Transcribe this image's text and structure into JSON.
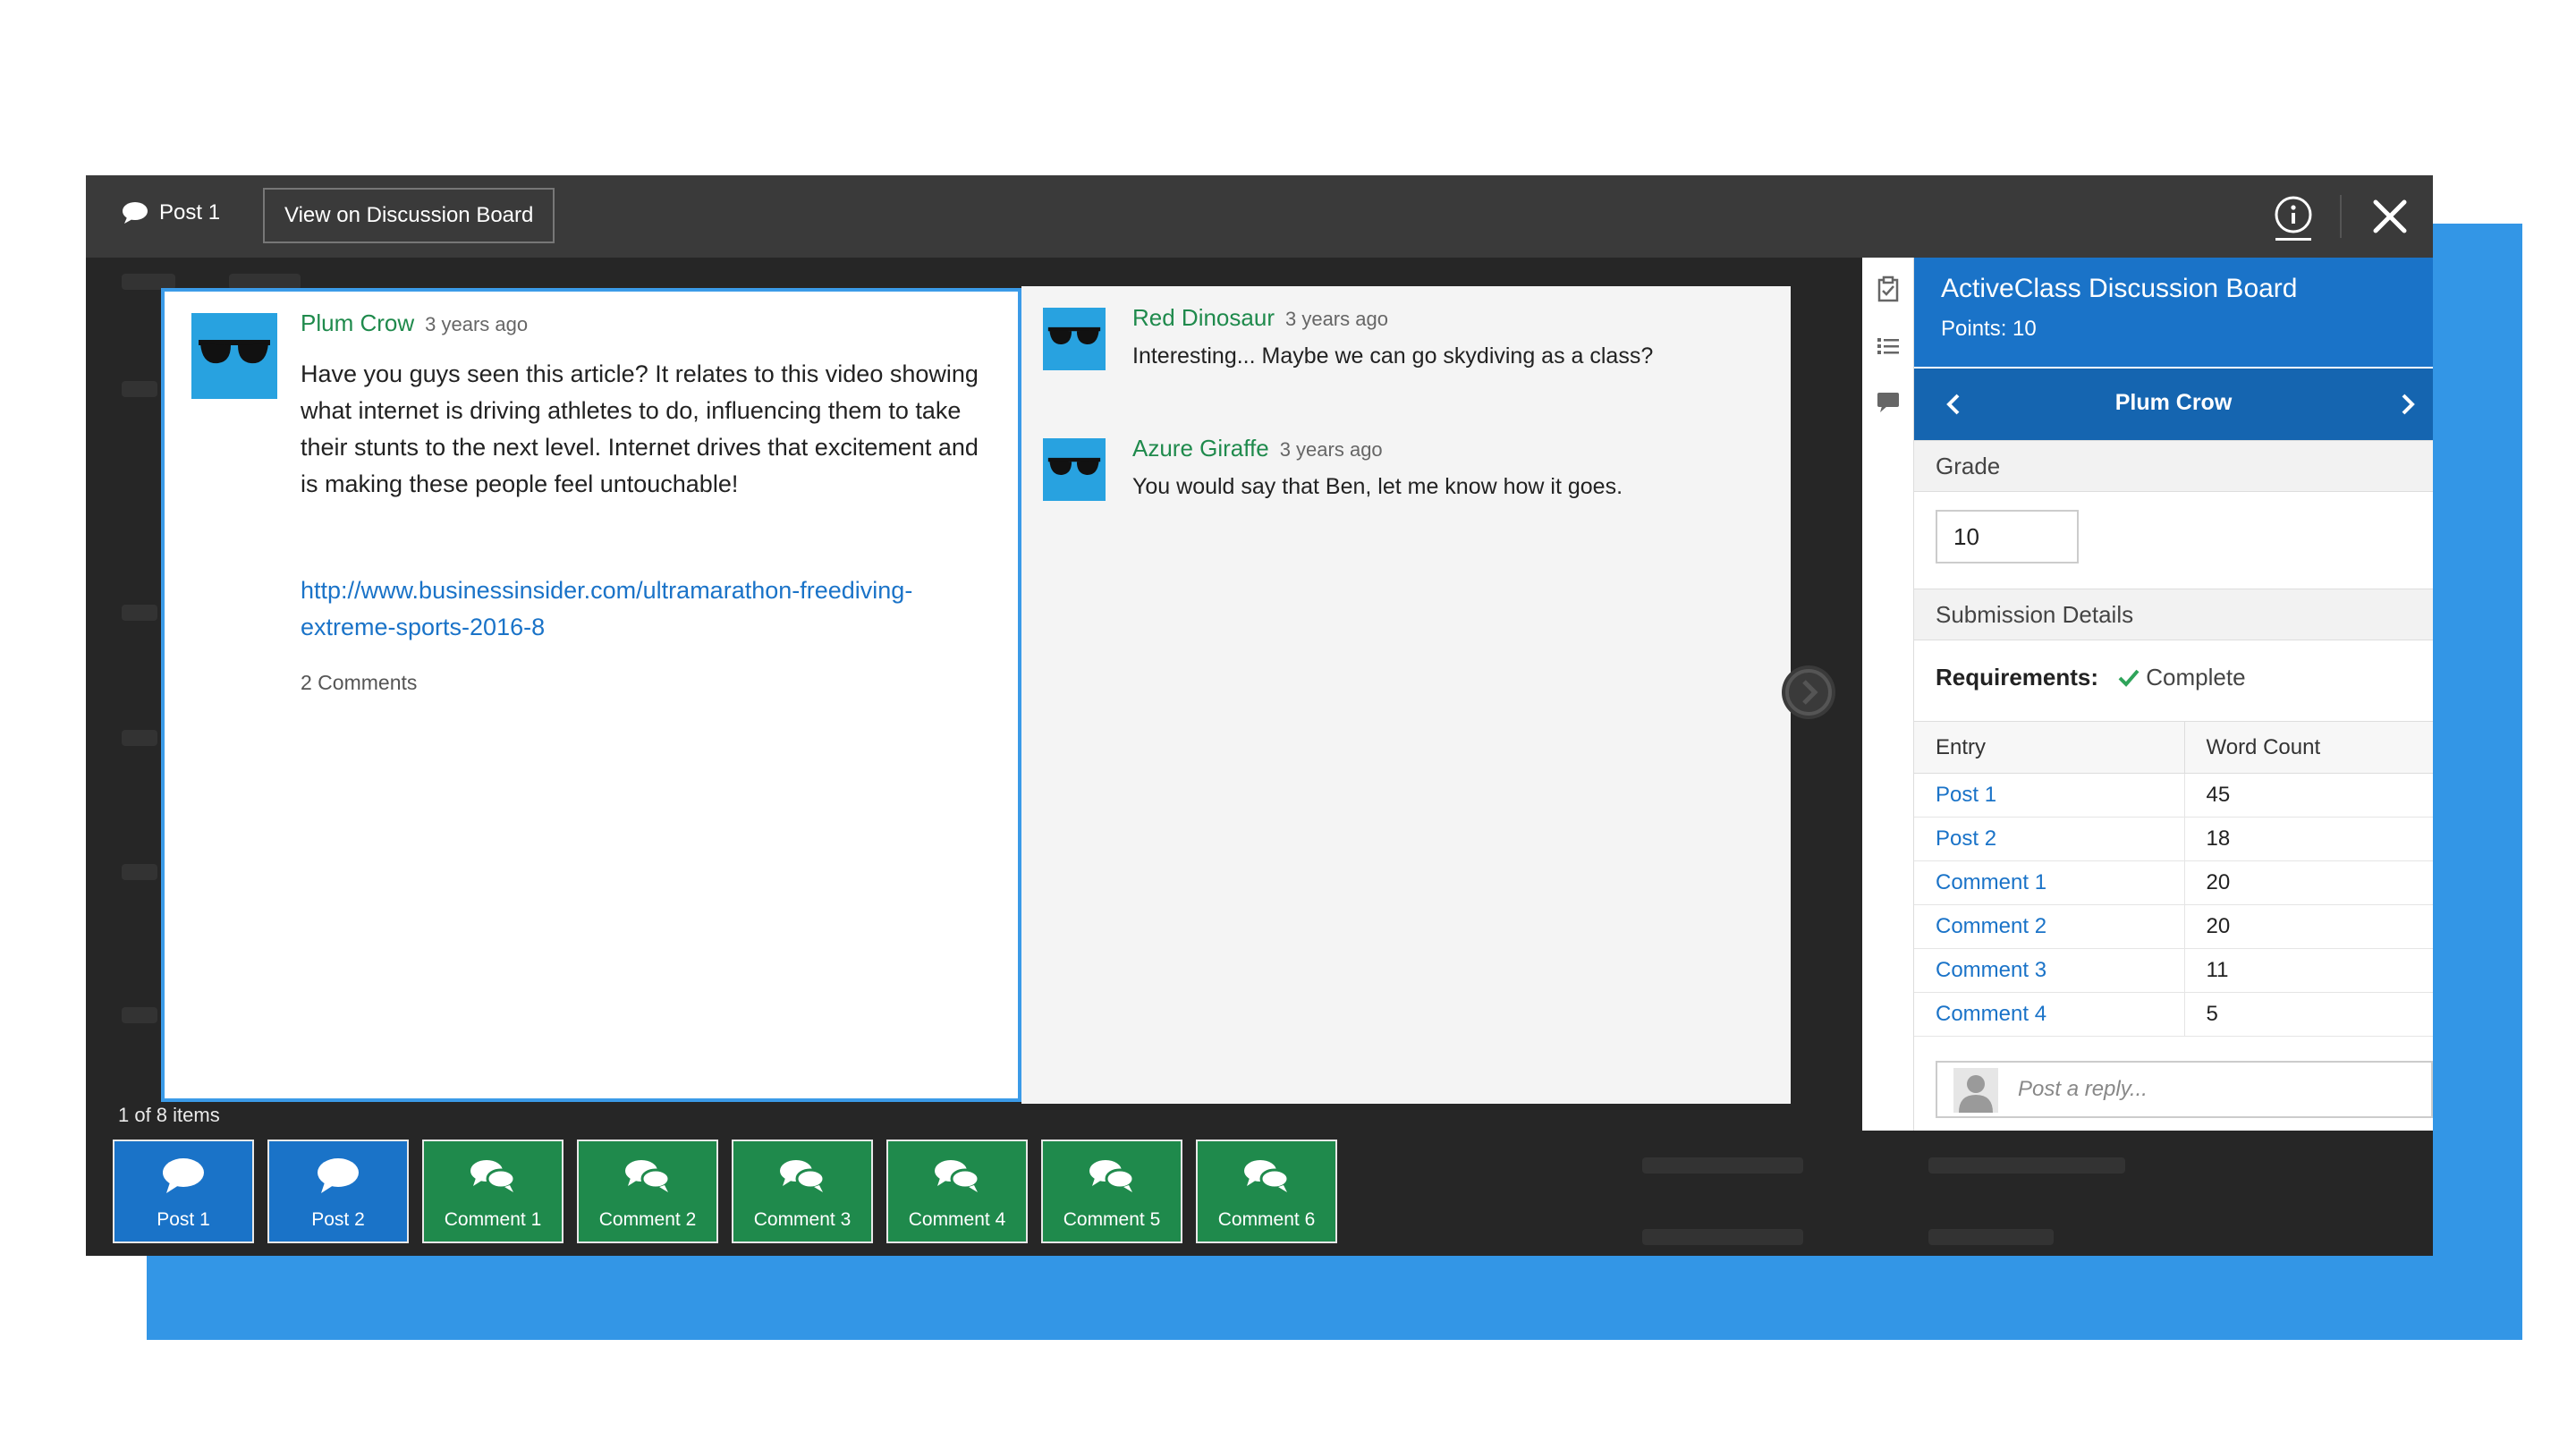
{
  "header": {
    "post_label": "Post 1",
    "view_button": "View on Discussion Board"
  },
  "post": {
    "author": "Plum Crow",
    "time": "3 years ago",
    "body": "Have you guys seen this article? It relates to this video showing what internet is driving athletes to do, influencing them to take their stunts to the next level. Internet drives that excitement and is making these people feel untouchable!",
    "link": "http://www.businessinsider.com/ultramarathon-freediving-extreme-sports-2016-8",
    "comments_count": "2 Comments"
  },
  "comments": [
    {
      "author": "Red Dinosaur",
      "time": "3 years ago",
      "text": "Interesting... Maybe we can go skydiving as a class?"
    },
    {
      "author": "Azure Giraffe",
      "time": "3 years ago",
      "text": "You would say that Ben, let me know how it goes."
    }
  ],
  "footer": {
    "items_count": "1 of 8 items",
    "tiles": [
      {
        "label": "Post 1",
        "kind": "post"
      },
      {
        "label": "Post 2",
        "kind": "post"
      },
      {
        "label": "Comment 1",
        "kind": "comment"
      },
      {
        "label": "Comment 2",
        "kind": "comment"
      },
      {
        "label": "Comment 3",
        "kind": "comment"
      },
      {
        "label": "Comment 4",
        "kind": "comment"
      },
      {
        "label": "Comment 5",
        "kind": "comment"
      },
      {
        "label": "Comment 6",
        "kind": "comment"
      }
    ]
  },
  "panel": {
    "title": "ActiveClass Discussion Board",
    "points": "Points: 10",
    "student": "Plum Crow",
    "grade_label": "Grade",
    "grade_value": "10",
    "submission_label": "Submission Details",
    "requirements_label": "Requirements:",
    "requirements_status": "Complete",
    "table_headers": [
      "Entry",
      "Word Count"
    ],
    "table_rows": [
      {
        "entry": "Post 1",
        "count": "45"
      },
      {
        "entry": "Post 2",
        "count": "18"
      },
      {
        "entry": "Comment 1",
        "count": "20"
      },
      {
        "entry": "Comment 2",
        "count": "20"
      },
      {
        "entry": "Comment 3",
        "count": "11"
      },
      {
        "entry": "Comment 4",
        "count": "5"
      }
    ],
    "reply_placeholder": "Post a reply..."
  },
  "colors": {
    "accent_blue": "#1a73c8",
    "comment_green": "#1f8a4c",
    "backdrop_blue": "#3396e6"
  }
}
